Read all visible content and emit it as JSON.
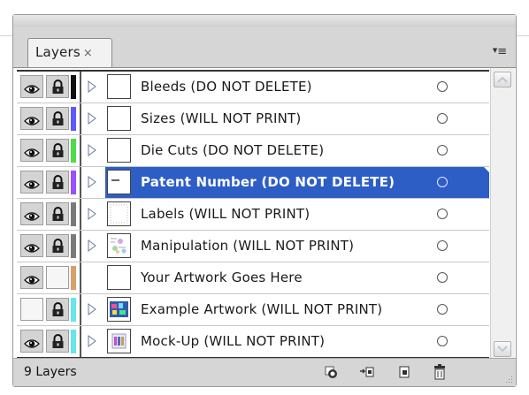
{
  "panel": {
    "tab_label": "Layers",
    "close_glyph": "×",
    "menu_glyph": "≡"
  },
  "layers": [
    {
      "name": "Bleeds (DO NOT DELETE)",
      "visible": true,
      "locked": true,
      "color": "#111111",
      "expandable": true,
      "thumb": "blank",
      "selected": false
    },
    {
      "name": "Sizes (WILL NOT PRINT)",
      "visible": true,
      "locked": true,
      "color": "#5a5aff",
      "expandable": true,
      "thumb": "blank",
      "selected": false
    },
    {
      "name": "Die Cuts (DO NOT DELETE)",
      "visible": true,
      "locked": true,
      "color": "#4cdc4c",
      "expandable": true,
      "thumb": "blank",
      "selected": false
    },
    {
      "name": "Patent Number (DO NOT DELETE)",
      "visible": true,
      "locked": true,
      "color": "#9b4dff",
      "expandable": true,
      "thumb": "dash",
      "selected": true
    },
    {
      "name": "Labels (WILL NOT PRINT)",
      "visible": true,
      "locked": true,
      "color": "#7a7a7a",
      "expandable": true,
      "thumb": "dotted",
      "selected": false
    },
    {
      "name": "Manipulation (WILL NOT PRINT)",
      "visible": true,
      "locked": true,
      "color": "#7a7a7a",
      "expandable": true,
      "thumb": "pattern",
      "selected": false
    },
    {
      "name": "Your Artwork Goes Here",
      "visible": true,
      "locked": false,
      "color": "#d6a06a",
      "expandable": false,
      "thumb": "blank",
      "selected": false
    },
    {
      "name": "Example Artwork (WILL NOT PRINT)",
      "visible": false,
      "locked": true,
      "color": "#66e6ee",
      "expandable": true,
      "thumb": "art",
      "selected": false
    },
    {
      "name": "Mock-Up (WILL NOT PRINT)",
      "visible": true,
      "locked": true,
      "color": "#66e6ee",
      "expandable": true,
      "thumb": "mock",
      "selected": false
    }
  ],
  "footer": {
    "layer_count": "9 Layers",
    "buttons": [
      "make-clipping-mask",
      "create-sublayer",
      "create-new-layer",
      "delete-layer"
    ]
  }
}
